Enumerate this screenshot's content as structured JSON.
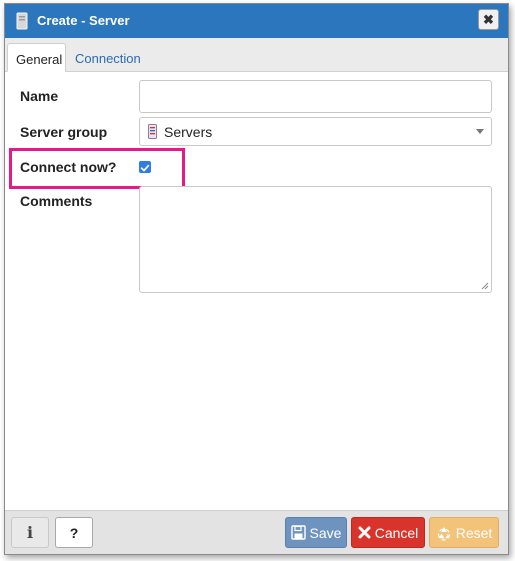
{
  "dialog": {
    "title": "Create - Server",
    "icons": {
      "title": "server-icon",
      "close": "close-icon"
    },
    "close_label": "✖"
  },
  "tabs": [
    {
      "label": "General",
      "active": true
    },
    {
      "label": "Connection",
      "active": false
    }
  ],
  "form": {
    "name": {
      "label": "Name",
      "value": "",
      "placeholder": ""
    },
    "server_group": {
      "label": "Server group",
      "value": "Servers",
      "icon": "server-group-icon"
    },
    "connect_now": {
      "label": "Connect now?",
      "checked": true
    },
    "comments": {
      "label": "Comments",
      "value": ""
    }
  },
  "footer": {
    "info_label": "i",
    "help_label": "?",
    "save_label": "Save",
    "cancel_label": "Cancel",
    "reset_label": "Reset",
    "icons": {
      "save": "floppy-icon",
      "cancel": "x-icon",
      "reset": "recycle-icon"
    }
  },
  "colors": {
    "titlebar": "#2c76be",
    "highlight": "#e6198a",
    "save": "#6f93bf",
    "cancel": "#d9342b",
    "reset": "#f3c37a",
    "checkbox": "#2f7ce6"
  }
}
